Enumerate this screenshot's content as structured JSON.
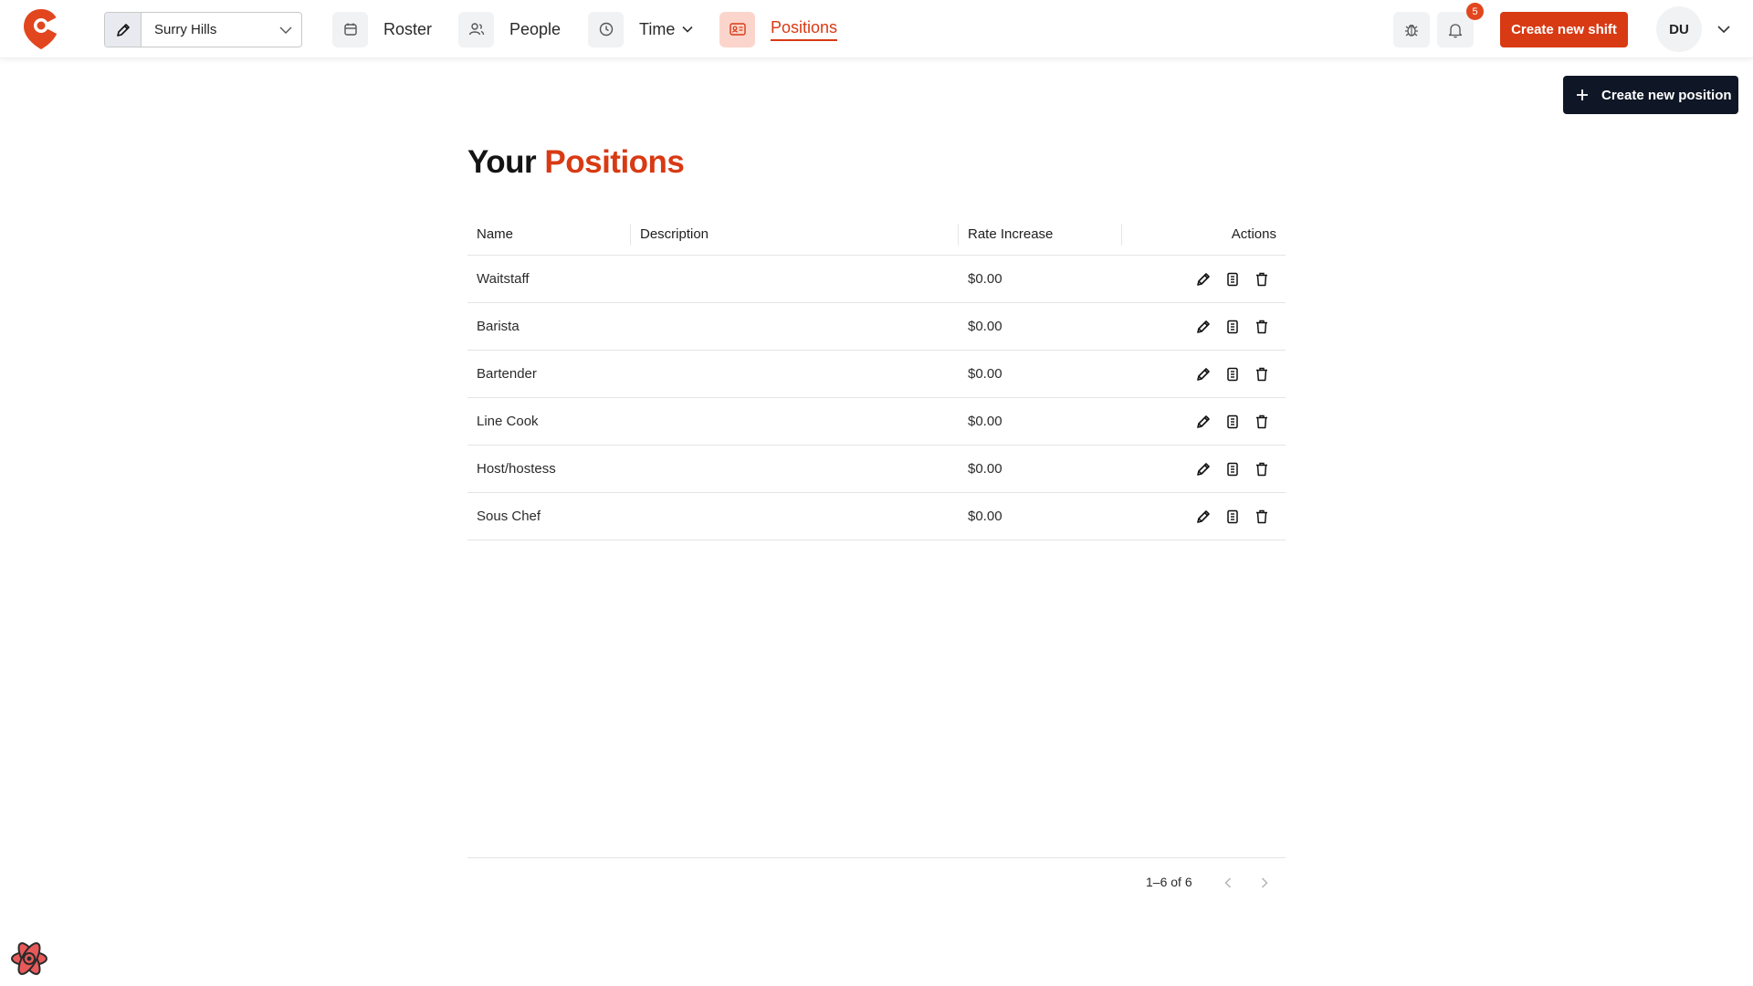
{
  "colors": {
    "brand": "#d83a14",
    "dark_button": "#0f1626",
    "active_nav_bg": "#fbd5cc"
  },
  "header": {
    "location": "Surry Hills",
    "nav": [
      {
        "label": "Roster",
        "icon": "calendar-icon"
      },
      {
        "label": "People",
        "icon": "people-icon"
      },
      {
        "label": "Time",
        "icon": "clock-icon"
      },
      {
        "label": "Positions",
        "icon": "id-card-icon",
        "active": true
      }
    ],
    "notification_count": "5",
    "create_shift_label": "Create new shift",
    "user_initials": "DU"
  },
  "create_position_label": "Create new position",
  "title": {
    "prefix": "Your",
    "accent": "Positions"
  },
  "table": {
    "columns": [
      "Name",
      "Description",
      "Rate Increase",
      "Actions"
    ],
    "rows": [
      {
        "name": "Waitstaff",
        "description": "",
        "rate": "$0.00"
      },
      {
        "name": "Barista",
        "description": "",
        "rate": "$0.00"
      },
      {
        "name": "Bartender",
        "description": "",
        "rate": "$0.00"
      },
      {
        "name": "Line Cook",
        "description": "",
        "rate": "$0.00"
      },
      {
        "name": "Host/hostess",
        "description": "",
        "rate": "$0.00"
      },
      {
        "name": "Sous Chef",
        "description": "",
        "rate": "$0.00"
      }
    ]
  },
  "pagination": {
    "range": "1–6 of 6"
  }
}
